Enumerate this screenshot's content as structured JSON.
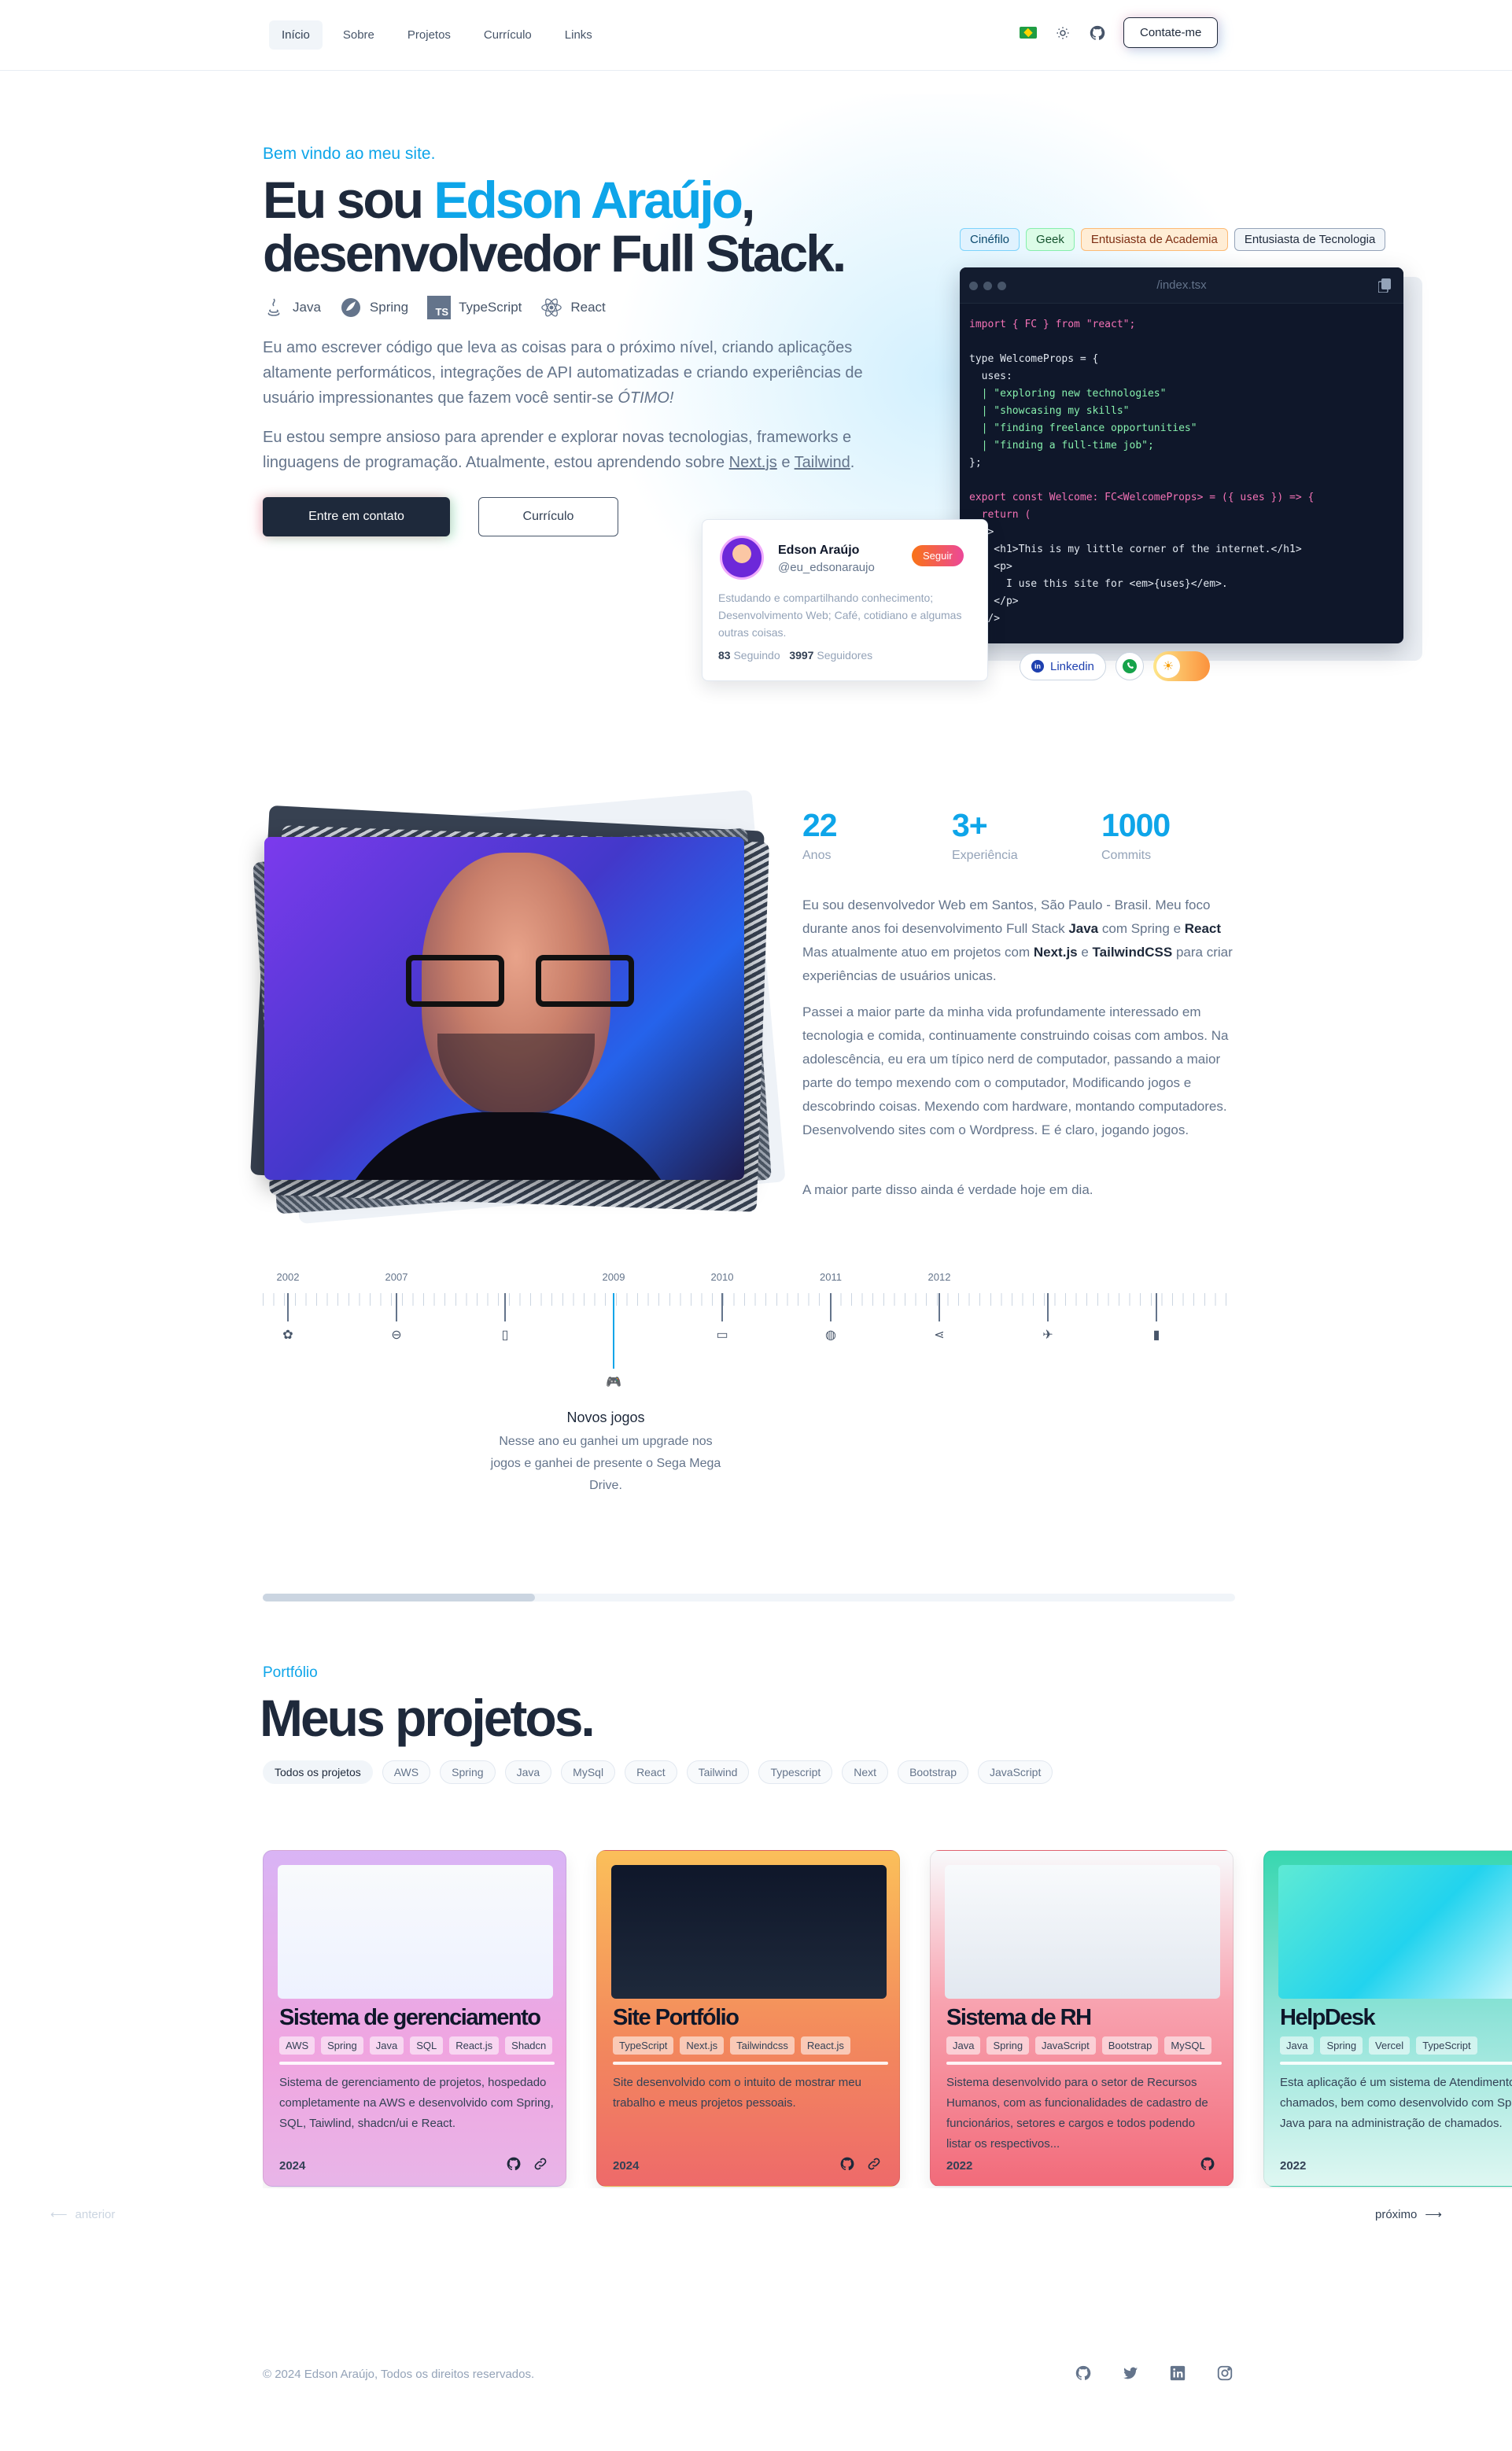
{
  "nav": {
    "links": [
      "Início",
      "Sobre",
      "Projetos",
      "Currículo",
      "Links"
    ],
    "contact_label": "Contate-me"
  },
  "hero": {
    "kicker": "Bem vindo ao meu site.",
    "title_pre": "Eu sou ",
    "title_name": "Edson Araújo",
    "title_comma": ",",
    "title_line2": "desenvolvedor Full Stack.",
    "techs": [
      "Java",
      "Spring",
      "TypeScript",
      "React"
    ],
    "p1_text": "Eu amo escrever código que leva as coisas para o próximo nível, criando aplicações altamente performáticos, integrações de API automatizadas e criando experiências de usuário impressionantes que fazem você sentir-se ",
    "p1_emph": "ÓTIMO!",
    "p2_text": "Eu estou sempre ansioso para aprender e explorar novas tecnologias, frameworks e linguagens de programação. Atualmente, estou aprendendo sobre ",
    "p2_link1": "Next.js",
    "p2_and": " e ",
    "p2_link2": "Tailwind",
    "p2_end": ".",
    "btn_contact": "Entre em contato",
    "btn_cv": "Currículo",
    "chips": [
      "Cinéfilo",
      "Geek",
      "Entusiasta de Academia",
      "Entusiasta de Tecnologia"
    ]
  },
  "editor": {
    "filename": "/index.tsx",
    "lines": [
      "import { FC } from \"react\";",
      "",
      "type WelcomeProps = {",
      "  uses:",
      "  | \"exploring new technologies\"",
      "  | \"showcasing my skills\"",
      "  | \"finding freelance opportunities\"",
      "  | \"finding a full-time job\";",
      "};",
      "",
      "export const Welcome: FC<WelcomeProps> = ({ uses }) => {",
      "  return (",
      "  <>",
      "    <h1>This is my little corner of the internet.</h1>",
      "    <p>",
      "      I use this site for <em>{uses}</em>.",
      "    </p>",
      "  </>"
    ]
  },
  "profile": {
    "name": "Edson Araújo",
    "handle": "@eu_edsonaraujo",
    "follow_label": "Seguir",
    "bio": "Estudando e compartilhando conhecimento; Desenvolvimento Web; Café, cotidiano e algumas outras coisas.",
    "following_count": "83",
    "following_label": "Seguindo",
    "followers_count": "3997",
    "followers_label": "Seguidores"
  },
  "social": {
    "linkedin_label": "Linkedin"
  },
  "about": {
    "stats": [
      {
        "value": "22",
        "label": "Anos"
      },
      {
        "value": "3+",
        "label": "Experiência"
      },
      {
        "value": "1000",
        "label": "Commits"
      }
    ],
    "p1": {
      "a": "Eu sou desenvolvedor Web em Santos, São Paulo - Brasil. Meu foco durante anos foi desenvolvimento Full Stack ",
      "b1": "Java",
      "c": " com Spring e ",
      "b2": "React",
      "d": " Mas atualmente atuo em projetos com ",
      "b3": "Next.js",
      "e": " e ",
      "b4": "TailwindCSS",
      "f": " para criar experiências de usuários unicas."
    },
    "p2": "Passei a maior parte da minha vida profundamente interessado em tecnologia e comida, continuamente construindo coisas com ambos. Na adolescência, eu era um típico nerd de computador, passando a maior parte do tempo mexendo com o computador, Modificando jogos e descobrindo coisas. Mexendo com hardware, montando computadores. Desenvolvendo sites com o Wordpress. E é claro, jogando jogos.",
    "p3": "A maior parte disso ainda é verdade hoje em dia."
  },
  "timeline": {
    "items": [
      {
        "year": "2002",
        "icon": "baby-icon",
        "glyph": "✿"
      },
      {
        "year": "2007",
        "icon": "gamepad-icon",
        "glyph": "⊖"
      },
      {
        "year": "",
        "icon": "phone-icon",
        "glyph": "▯"
      },
      {
        "year": "2009",
        "icon": "gamepad-active-icon",
        "glyph": "🎮",
        "active": true
      },
      {
        "year": "2010",
        "icon": "monitor-icon",
        "glyph": "▭"
      },
      {
        "year": "2011",
        "icon": "mouse-icon",
        "glyph": "◍"
      },
      {
        "year": "2012",
        "icon": "share-icon",
        "glyph": "⋖"
      },
      {
        "year": "",
        "icon": "plane-icon",
        "glyph": "✈"
      },
      {
        "year": "",
        "icon": "device-icon",
        "glyph": "▮"
      }
    ],
    "active_title": "Novos jogos",
    "active_desc": "Nesse ano eu ganhei um upgrade nos jogos e ganhei de presente o Sega Mega Drive.",
    "progress": 0.28
  },
  "portfolio": {
    "kicker": "Portfólio",
    "title": "Meus projetos.",
    "filters": [
      "Todos os projetos",
      "AWS",
      "Spring",
      "Java",
      "MySql",
      "React",
      "Tailwind",
      "Typescript",
      "Next",
      "Bootstrap",
      "JavaScript"
    ],
    "projects": [
      {
        "title": "Sistema de gerenciamento",
        "tags": [
          "AWS",
          "Spring",
          "Java",
          "SQL",
          "React.js",
          "Shadcn"
        ],
        "desc": "Sistema de gerenciamento de projetos, hospedado completamente na AWS e desenvolvido com Spring, SQL, Taiwlind, shadcn/ui e React.",
        "year": "2024",
        "bg": "#e9a6e4"
      },
      {
        "title": "Site Portfólio",
        "tags": [
          "TypeScript",
          "Next.js",
          "Tailwindcss",
          "React.js"
        ],
        "desc": "Site desenvolvido com o intuito de mostrar meu trabalho e meus projetos pessoais.",
        "year": "2024",
        "bg": "#f58a6a"
      },
      {
        "title": "Sistema de RH",
        "tags": [
          "Java",
          "Spring",
          "JavaScript",
          "Bootstrap",
          "MySQL"
        ],
        "desc": "Sistema desenvolvido para o setor de Recursos Humanos, com as funcionalidades de cadastro de funcionários, setores e cargos e todos podendo listar os respectivos...",
        "year": "2022",
        "bg": "#f47a8a"
      },
      {
        "title": "HelpDesk",
        "tags": [
          "Java",
          "Spring",
          "Vercel",
          "TypeScript"
        ],
        "desc": "Esta aplicação é um sistema de Atendimento de chamados, bem como desenvolvido com Spring e Java para na administração de chamados.",
        "year": "2022",
        "bg": "#2fc9a8"
      }
    ],
    "prev_label": "anterior",
    "next_label": "próximo"
  },
  "footer": {
    "copyright": "© 2024 Edson Araújo, Todos os direitos reservados."
  },
  "colors": {
    "accent": "#0ea5e9",
    "dark": "#1e293b"
  }
}
